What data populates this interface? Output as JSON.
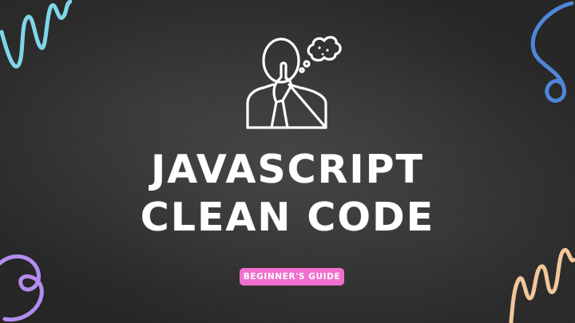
{
  "title": {
    "line1": "JAVASCRIPT",
    "line2": "CLEAN CODE"
  },
  "badge": {
    "label": "BEGINNER'S GUIDE"
  },
  "illustration": {
    "icon": "thinking-person-icon"
  },
  "colors": {
    "background": "#2d2d2d",
    "title_text": "#ffffff",
    "badge_background": "#f16fcf",
    "scribble_top_left": "#7fd6e8",
    "scribble_top_right": "#4f86d8",
    "scribble_bottom_left": "#b48cf0",
    "scribble_bottom_right": "#f2c79a"
  }
}
